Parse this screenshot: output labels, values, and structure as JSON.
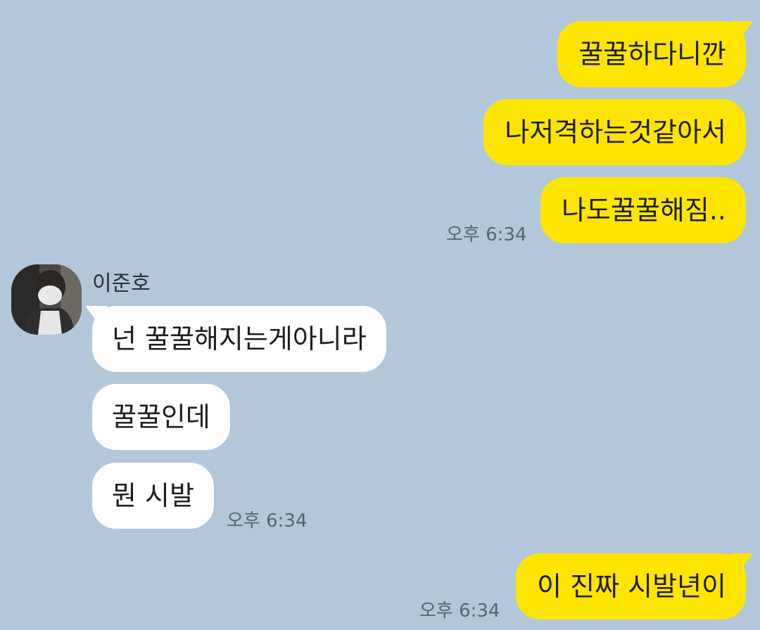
{
  "colors": {
    "background": "#b2c7da",
    "my_bubble": "#fee500",
    "other_bubble": "#ffffff"
  },
  "messages_me_1": [
    {
      "text": "꿀꿀하다니깐"
    },
    {
      "text": "나저격하는것같아서"
    },
    {
      "text": "나도꿀꿀해짐.."
    }
  ],
  "messages_me_1_time": "오후 6:34",
  "other_sender": {
    "name": "이준호",
    "avatar_icon": "profile-photo"
  },
  "messages_other": [
    {
      "text": "넌 꿀꿀해지는게아니라"
    },
    {
      "text": "꿀꿀인데"
    },
    {
      "text": "뭔 시발"
    }
  ],
  "messages_other_time": "오후 6:34",
  "messages_me_2": [
    {
      "text": "이 진짜 시발년이"
    }
  ],
  "messages_me_2_time": "오후 6:34"
}
